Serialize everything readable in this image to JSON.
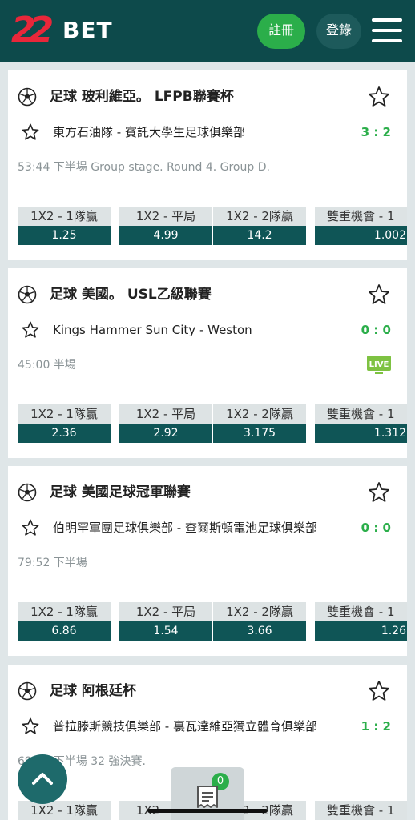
{
  "header": {
    "logo_digits": "22",
    "logo_text": "BET",
    "register_label": "註冊",
    "login_label": "登錄",
    "menu_icon": "hamburger-menu-icon"
  },
  "colors": {
    "header_bg": "#0d4a4b",
    "accent_green": "#2bae4a",
    "odds_value_bg": "#0f5556",
    "odds_label_bg": "#dde3e4",
    "page_bg": "#dfe6e8"
  },
  "matches": [
    {
      "league": "足球 玻利維亞。 LFPB聯賽杯",
      "teams": "東方石油隊 - 賓託大學生足球俱樂部",
      "score": "3 : 2",
      "status": "53:44 下半場    Group stage. Round 4. Group D.",
      "live": false,
      "odds": [
        {
          "label": "1X2 - 1隊贏",
          "value": "1.25"
        },
        {
          "label": "1X2 - 平局",
          "value": "4.99"
        },
        {
          "label": "1X2 - 2隊贏",
          "value": "14.2"
        },
        {
          "label": "雙重機會 - 1",
          "value": "1.002"
        }
      ]
    },
    {
      "league": "足球 美國。 USL乙級聯賽",
      "teams": "Kings Hammer Sun City - Weston",
      "score": "0 : 0",
      "status": "45:00 半場",
      "live": true,
      "live_label": "LIVE",
      "odds": [
        {
          "label": "1X2 - 1隊贏",
          "value": "2.36"
        },
        {
          "label": "1X2 - 平局",
          "value": "2.92"
        },
        {
          "label": "1X2 - 2隊贏",
          "value": "3.175"
        },
        {
          "label": "雙重機會 - 1",
          "value": "1.312"
        }
      ]
    },
    {
      "league": "足球 美國足球冠軍聯賽",
      "teams": "伯明罕軍團足球俱樂部 - 查爾斯頓電池足球俱樂部",
      "score": "0 : 0",
      "status": "79:52 下半場",
      "live": false,
      "odds": [
        {
          "label": "1X2 - 1隊贏",
          "value": "6.86"
        },
        {
          "label": "1X2 - 平局",
          "value": "1.54"
        },
        {
          "label": "1X2 - 2隊贏",
          "value": "3.66"
        },
        {
          "label": "雙重機會 - 1",
          "value": "1.26"
        }
      ]
    },
    {
      "league": "足球 阿根廷杯",
      "teams": "普拉滕斯競技俱樂部 - 裏瓦達維亞獨立體育俱樂部",
      "score": "1 : 2",
      "status": "69:50 下半場    32 強決賽.",
      "live": false,
      "odds": [
        {
          "label": "1X2 - 1隊贏",
          "value": ""
        },
        {
          "label": "1X2 - 平局",
          "value": ""
        },
        {
          "label": "1X2 - 2隊贏",
          "value": ""
        },
        {
          "label": "雙重機會 - 1",
          "value": ""
        }
      ]
    }
  ],
  "betslip": {
    "count": "0"
  }
}
